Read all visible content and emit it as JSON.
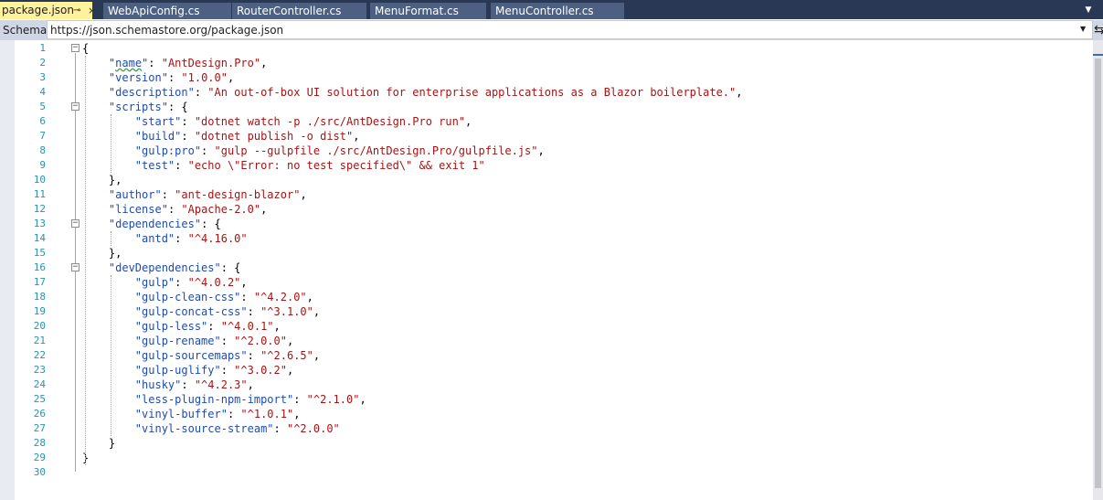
{
  "tabs": [
    {
      "label": "package.json",
      "active": true
    },
    {
      "label": "WebApiConfig.cs",
      "active": false
    },
    {
      "label": "RouterController.cs",
      "active": false
    },
    {
      "label": "MenuFormat.cs",
      "active": false
    },
    {
      "label": "MenuController.cs",
      "active": false
    }
  ],
  "tab_pin_icon": "pin-icon",
  "tab_close_icon": "close-icon",
  "schema": {
    "label": "Schema:",
    "value": "https://json.schemastore.org/package.json"
  },
  "line_numbers": [
    "1",
    "2",
    "3",
    "4",
    "5",
    "6",
    "7",
    "8",
    "9",
    "10",
    "11",
    "12",
    "13",
    "14",
    "15",
    "16",
    "17",
    "18",
    "19",
    "20",
    "21",
    "22",
    "23",
    "24",
    "25",
    "26",
    "27",
    "28",
    "29",
    "30"
  ],
  "code_lines": [
    [
      {
        "t": "{",
        "c": "p"
      }
    ],
    [
      {
        "t": "  ",
        "c": "p"
      },
      {
        "t": "\"",
        "c": "k"
      },
      {
        "t": "name",
        "c": "k sq"
      },
      {
        "t": "\"",
        "c": "k"
      },
      {
        "t": ": ",
        "c": "p"
      },
      {
        "t": "\"AntDesign.Pro\"",
        "c": "s"
      },
      {
        "t": ",",
        "c": "p"
      }
    ],
    [
      {
        "t": "  ",
        "c": "p"
      },
      {
        "t": "\"version\"",
        "c": "k"
      },
      {
        "t": ": ",
        "c": "p"
      },
      {
        "t": "\"1.0.0\"",
        "c": "s"
      },
      {
        "t": ",",
        "c": "p"
      }
    ],
    [
      {
        "t": "  ",
        "c": "p"
      },
      {
        "t": "\"description\"",
        "c": "k"
      },
      {
        "t": ": ",
        "c": "p"
      },
      {
        "t": "\"An out-of-box UI solution for enterprise applications as a Blazor boilerplate.\"",
        "c": "s"
      },
      {
        "t": ",",
        "c": "p"
      }
    ],
    [
      {
        "t": "  ",
        "c": "p"
      },
      {
        "t": "\"scripts\"",
        "c": "k"
      },
      {
        "t": ": {",
        "c": "p"
      }
    ],
    [
      {
        "t": "    ",
        "c": "p"
      },
      {
        "t": "\"start\"",
        "c": "k"
      },
      {
        "t": ": ",
        "c": "p"
      },
      {
        "t": "\"dotnet watch -p ./src/AntDesign.Pro run\"",
        "c": "s"
      },
      {
        "t": ",",
        "c": "p"
      }
    ],
    [
      {
        "t": "    ",
        "c": "p"
      },
      {
        "t": "\"build\"",
        "c": "k"
      },
      {
        "t": ": ",
        "c": "p"
      },
      {
        "t": "\"dotnet publish -o dist\"",
        "c": "s"
      },
      {
        "t": ",",
        "c": "p"
      }
    ],
    [
      {
        "t": "    ",
        "c": "p"
      },
      {
        "t": "\"gulp:pro\"",
        "c": "k"
      },
      {
        "t": ": ",
        "c": "p"
      },
      {
        "t": "\"gulp --gulpfile ./src/AntDesign.Pro/gulpfile.js\"",
        "c": "s"
      },
      {
        "t": ",",
        "c": "p"
      }
    ],
    [
      {
        "t": "    ",
        "c": "p"
      },
      {
        "t": "\"test\"",
        "c": "k"
      },
      {
        "t": ": ",
        "c": "p"
      },
      {
        "t": "\"echo \\\"Error: no test specified\\\" && exit 1\"",
        "c": "s"
      }
    ],
    [
      {
        "t": "  },",
        "c": "p"
      }
    ],
    [
      {
        "t": "  ",
        "c": "p"
      },
      {
        "t": "\"author\"",
        "c": "k"
      },
      {
        "t": ": ",
        "c": "p"
      },
      {
        "t": "\"ant-design-blazor\"",
        "c": "s"
      },
      {
        "t": ",",
        "c": "p"
      }
    ],
    [
      {
        "t": "  ",
        "c": "p"
      },
      {
        "t": "\"license\"",
        "c": "k"
      },
      {
        "t": ": ",
        "c": "p"
      },
      {
        "t": "\"Apache-2.0\"",
        "c": "s"
      },
      {
        "t": ",",
        "c": "p"
      }
    ],
    [
      {
        "t": "  ",
        "c": "p"
      },
      {
        "t": "\"dependencies\"",
        "c": "k"
      },
      {
        "t": ": {",
        "c": "p"
      }
    ],
    [
      {
        "t": "    ",
        "c": "p"
      },
      {
        "t": "\"antd\"",
        "c": "k"
      },
      {
        "t": ": ",
        "c": "p"
      },
      {
        "t": "\"^4.16.0\"",
        "c": "s"
      }
    ],
    [
      {
        "t": "  },",
        "c": "p"
      }
    ],
    [
      {
        "t": "  ",
        "c": "p"
      },
      {
        "t": "\"devDependencies\"",
        "c": "k"
      },
      {
        "t": ": {",
        "c": "p"
      }
    ],
    [
      {
        "t": "    ",
        "c": "p"
      },
      {
        "t": "\"gulp\"",
        "c": "k"
      },
      {
        "t": ": ",
        "c": "p"
      },
      {
        "t": "\"^4.0.2\"",
        "c": "s"
      },
      {
        "t": ",",
        "c": "p"
      }
    ],
    [
      {
        "t": "    ",
        "c": "p"
      },
      {
        "t": "\"gulp-clean-css\"",
        "c": "k"
      },
      {
        "t": ": ",
        "c": "p"
      },
      {
        "t": "\"^4.2.0\"",
        "c": "s"
      },
      {
        "t": ",",
        "c": "p"
      }
    ],
    [
      {
        "t": "    ",
        "c": "p"
      },
      {
        "t": "\"gulp-concat-css\"",
        "c": "k"
      },
      {
        "t": ": ",
        "c": "p"
      },
      {
        "t": "\"^3.1.0\"",
        "c": "s"
      },
      {
        "t": ",",
        "c": "p"
      }
    ],
    [
      {
        "t": "    ",
        "c": "p"
      },
      {
        "t": "\"gulp-less\"",
        "c": "k"
      },
      {
        "t": ": ",
        "c": "p"
      },
      {
        "t": "\"^4.0.1\"",
        "c": "s"
      },
      {
        "t": ",",
        "c": "p"
      }
    ],
    [
      {
        "t": "    ",
        "c": "p"
      },
      {
        "t": "\"gulp-rename\"",
        "c": "k"
      },
      {
        "t": ": ",
        "c": "p"
      },
      {
        "t": "\"^2.0.0\"",
        "c": "s"
      },
      {
        "t": ",",
        "c": "p"
      }
    ],
    [
      {
        "t": "    ",
        "c": "p"
      },
      {
        "t": "\"gulp-sourcemaps\"",
        "c": "k"
      },
      {
        "t": ": ",
        "c": "p"
      },
      {
        "t": "\"^2.6.5\"",
        "c": "s"
      },
      {
        "t": ",",
        "c": "p"
      }
    ],
    [
      {
        "t": "    ",
        "c": "p"
      },
      {
        "t": "\"gulp-uglify\"",
        "c": "k"
      },
      {
        "t": ": ",
        "c": "p"
      },
      {
        "t": "\"^3.0.2\"",
        "c": "s"
      },
      {
        "t": ",",
        "c": "p"
      }
    ],
    [
      {
        "t": "    ",
        "c": "p"
      },
      {
        "t": "\"husky\"",
        "c": "k"
      },
      {
        "t": ": ",
        "c": "p"
      },
      {
        "t": "\"^4.2.3\"",
        "c": "s"
      },
      {
        "t": ",",
        "c": "p"
      }
    ],
    [
      {
        "t": "    ",
        "c": "p"
      },
      {
        "t": "\"less-plugin-npm-import\"",
        "c": "k"
      },
      {
        "t": ": ",
        "c": "p"
      },
      {
        "t": "\"^2.1.0\"",
        "c": "s"
      },
      {
        "t": ",",
        "c": "p"
      }
    ],
    [
      {
        "t": "    ",
        "c": "p"
      },
      {
        "t": "\"vinyl-buffer\"",
        "c": "k"
      },
      {
        "t": ": ",
        "c": "p"
      },
      {
        "t": "\"^1.0.1\"",
        "c": "s"
      },
      {
        "t": ",",
        "c": "p"
      }
    ],
    [
      {
        "t": "    ",
        "c": "p"
      },
      {
        "t": "\"vinyl-source-stream\"",
        "c": "k"
      },
      {
        "t": ": ",
        "c": "p"
      },
      {
        "t": "\"^2.0.0\"",
        "c": "s"
      }
    ],
    [
      {
        "t": "  }",
        "c": "p"
      }
    ],
    [
      {
        "t": "}",
        "c": "p"
      }
    ],
    []
  ],
  "colors": {
    "tab_active": "#fff29d",
    "tab_inactive": "#4d6082",
    "tabbar_bg": "#293955",
    "json_key": "#1f4bb0",
    "json_string": "#a31515",
    "line_number": "#2b91af"
  }
}
